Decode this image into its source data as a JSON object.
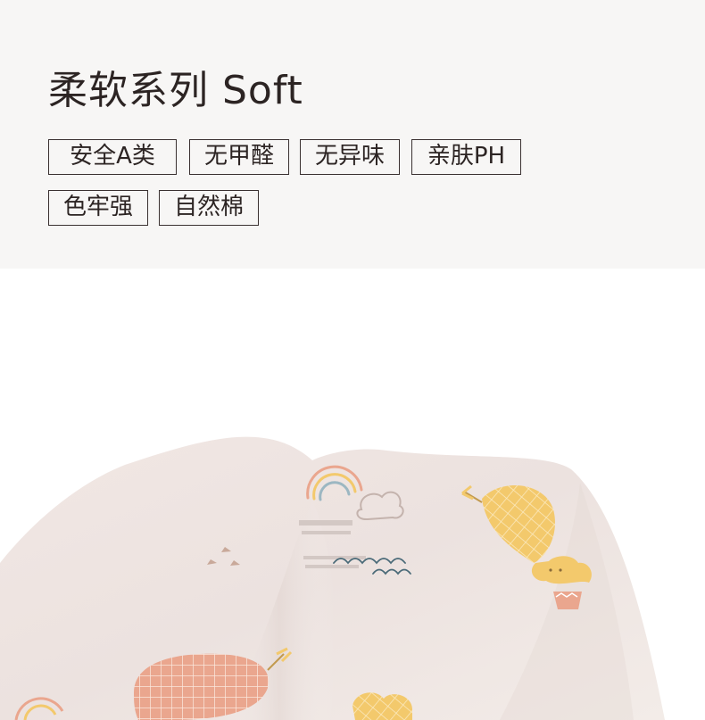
{
  "header": {
    "title": "柔软系列 Soft",
    "tags": [
      "安全A类",
      "无甲醛",
      "无异味",
      "亲肤PH",
      "色牢强",
      "自然棉"
    ]
  },
  "photo": {
    "subject": "fabric-with-balloon-print",
    "colors": {
      "fabric": "#efe6e3",
      "balloon_pink": "#eaa68e",
      "balloon_yellow": "#f3c96c",
      "wave_blue": "#4a6a78"
    }
  }
}
